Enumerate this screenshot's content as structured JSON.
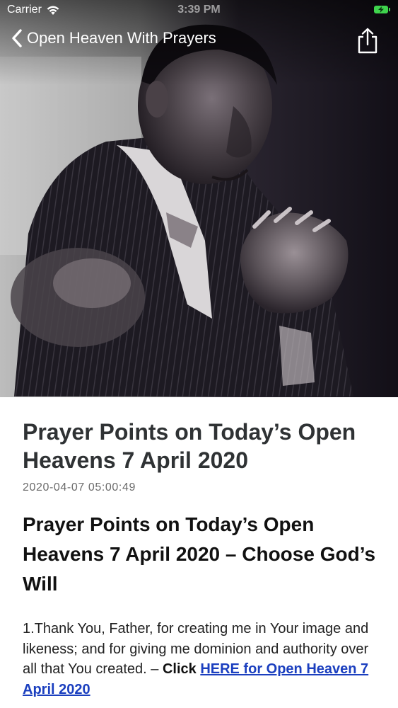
{
  "status_bar": {
    "carrier": "Carrier",
    "time": "3:39 PM"
  },
  "nav": {
    "back_label": "Open Heaven With Prayers",
    "back_icon": "chevron-left-icon",
    "share_icon": "share-icon"
  },
  "post": {
    "title": "Prayer Points on Today’s Open Heavens 7 April 2020",
    "date": "2020-04-07 05:00:49",
    "content_heading": "Prayer Points on Today’s Open Heavens 7 April 2020 – Choose God’s Will",
    "paragraph_text": "1.Thank You, Father, for creating me in Your image and likeness; and for giving me dominion and authority over all that You created. – ",
    "paragraph_bold": "Click",
    "paragraph_link": "HERE for Open Heaven 7 April 2020"
  },
  "colors": {
    "link": "#1b3fbf",
    "title": "#2f3234",
    "battery": "#3fd44d"
  }
}
